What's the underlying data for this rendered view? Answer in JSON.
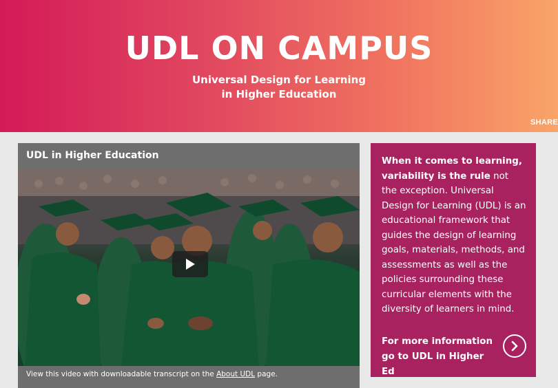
{
  "hero": {
    "title": "UDL ON CAMPUS",
    "subtitle_line1": "Universal Design for Learning",
    "subtitle_line2": "in Higher Education",
    "share_label": "SHARE",
    "gradient_colors": [
      "#d31a57",
      "#e0455f",
      "#f0735f",
      "#f9a468"
    ]
  },
  "video": {
    "title": "UDL in Higher Education",
    "play_icon": "play-icon",
    "caption_prefix": "View this video with downloadable transcript on the ",
    "caption_link": "About UDL",
    "caption_suffix": " page."
  },
  "info": {
    "intro_bold1": "When it comes to learning, variability is the rule",
    "intro_rest": " not the exception. Universal Design for Learning (UDL) is an educational framework that guides the design of learning goals, materials, methods, and assessments as well as the policies surrounding these curricular elements with the diversity of learners in mind.",
    "more_line1": "For more information",
    "more_line2": "go to UDL in Higher Ed",
    "more_icon": "chevron-right-circle-icon",
    "panel_color": "#a8225f"
  }
}
